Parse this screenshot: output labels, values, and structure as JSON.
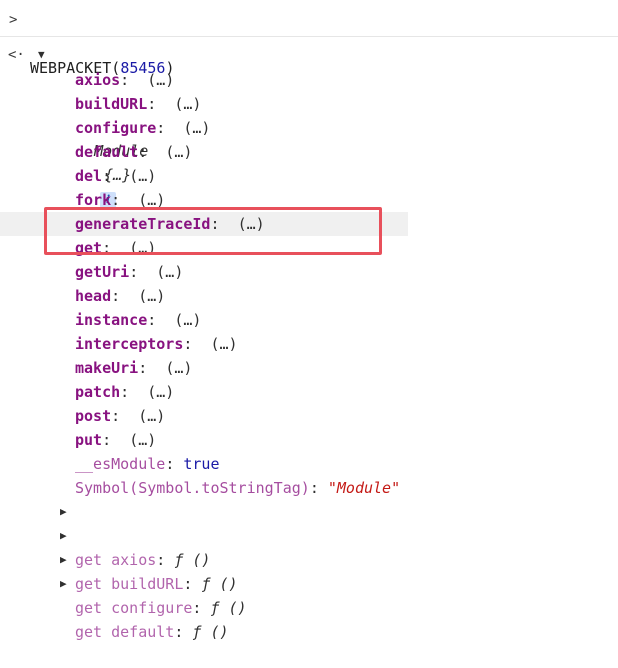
{
  "input_line": {
    "prompt_icon": "chevron-right-icon",
    "expression": "WEBPACKET",
    "open_paren": "(",
    "arg": "85456",
    "close_paren": ")"
  },
  "result": {
    "result_icon": "left-arrow-return-icon",
    "label": "Module",
    "preview": "{…}",
    "info_badge": "i",
    "properties": [
      {
        "name": "axios",
        "value": "(…)"
      },
      {
        "name": "buildURL",
        "value": "(…)"
      },
      {
        "name": "configure",
        "value": "(…)"
      },
      {
        "name": "default",
        "value": "(…)"
      },
      {
        "name": "del",
        "value": "(…)"
      },
      {
        "name": "fork",
        "value": "(…)"
      },
      {
        "name": "generateTraceId",
        "value": "(…)"
      },
      {
        "name": "get",
        "value": "(…)"
      },
      {
        "name": "getUri",
        "value": "(…)"
      },
      {
        "name": "head",
        "value": "(…)"
      },
      {
        "name": "instance",
        "value": "(…)"
      },
      {
        "name": "interceptors",
        "value": "(…)"
      },
      {
        "name": "makeUri",
        "value": "(…)"
      },
      {
        "name": "patch",
        "value": "(…)"
      },
      {
        "name": "post",
        "value": "(…)"
      },
      {
        "name": "put",
        "value": "(…)"
      }
    ],
    "es_module": {
      "name": "__esModule",
      "value": "true"
    },
    "to_string_tag": {
      "name": "Symbol(Symbol.toStringTag)",
      "value": "\"Module\""
    },
    "getters": [
      {
        "prefix": "get",
        "name": "axios",
        "value": "ƒ ()"
      },
      {
        "prefix": "get",
        "name": "buildURL",
        "value": "ƒ ()"
      },
      {
        "prefix": "get",
        "name": "configure",
        "value": "ƒ ()"
      },
      {
        "prefix": "get",
        "name": "default",
        "value": "ƒ ()"
      }
    ]
  },
  "colors": {
    "property_name": "#881280",
    "number": "#1a1aa6",
    "string": "#c41a16",
    "highlight_border": "#e8505b"
  }
}
